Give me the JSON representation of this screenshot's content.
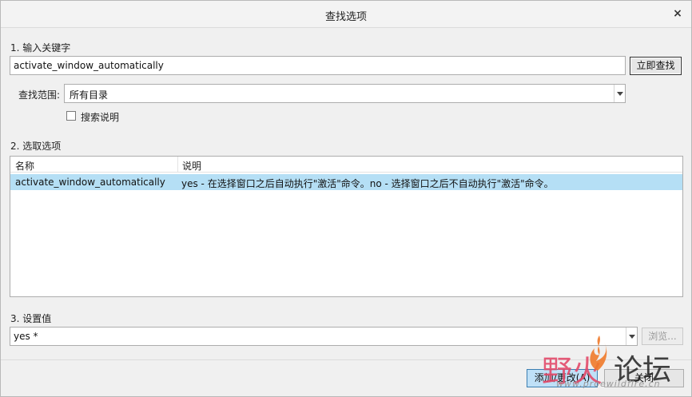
{
  "window": {
    "title": "查找选项",
    "close_label": "×"
  },
  "section1": {
    "label": "1. 输入关键字",
    "keyword_value": "activate_window_automatically",
    "find_now_button": "立即查找"
  },
  "scope": {
    "label": "查找范围:",
    "selected": "所有目录",
    "search_desc_checkbox_label": "搜索说明",
    "search_desc_checked": false
  },
  "section2": {
    "label": "2. 选取选项",
    "columns": [
      "名称",
      "说明"
    ],
    "rows": [
      {
        "name": "activate_window_automatically",
        "description": "yes - 在选择窗口之后自动执行\"激活\"命令。no - 选择窗口之后不自动执行\"激活\"命令。",
        "selected": true
      }
    ]
  },
  "section3": {
    "label": "3. 设置值",
    "value": "yes *",
    "browse_button": "浏览..."
  },
  "footer": {
    "add_change_button": "添加/更改(A)",
    "close_button": "关闭"
  },
  "watermark": {
    "text_left": "野火",
    "text_right": "论坛",
    "url": "www.proewildfire.cn"
  }
}
